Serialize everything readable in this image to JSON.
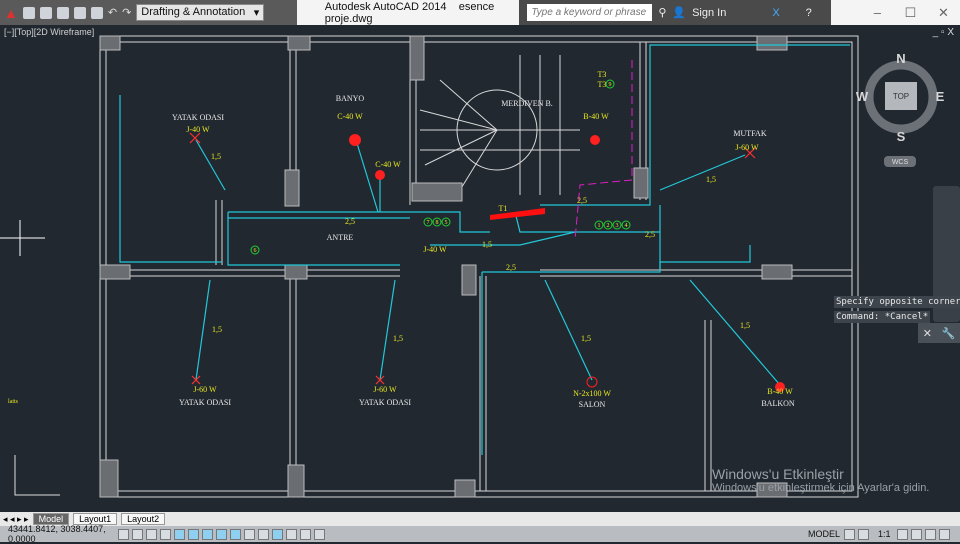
{
  "titlebar": {
    "workspace": "Drafting & Annotation",
    "app": "Autodesk AutoCAD 2014",
    "file": "esence proje.dwg",
    "search_placeholder": "Type a keyword or phrase",
    "sign_in": "Sign In",
    "minimize": "–",
    "maximize": "☐",
    "close": "✕"
  },
  "viewport": {
    "label": "[−][Top][2D Wireframe]",
    "controls": "_ ▫ X"
  },
  "viewcube": {
    "n": "N",
    "s": "S",
    "e": "E",
    "w": "W",
    "top": "TOP",
    "wcs": "WCS"
  },
  "drawing": {
    "rooms": [
      {
        "name": "YATAK ODASI",
        "load": "J-40 W"
      },
      {
        "name": "BANYO",
        "load": "C-40 W"
      },
      {
        "name": "MERDIVEN B.",
        "load": ""
      },
      {
        "name": "MUTFAK",
        "load": "J-60 W"
      },
      {
        "name": "ANTRE",
        "load": "J-40 W"
      },
      {
        "name": "YATAK ODASI",
        "load": "J-60 W"
      },
      {
        "name": "YATAK ODASI",
        "load": "J-60 W"
      },
      {
        "name": "SALON",
        "load": "N-2x100 W"
      },
      {
        "name": "BALKON",
        "load": "B-40 W"
      }
    ],
    "extra_loads": {
      "banyo2": "C-40 W",
      "stair": "B-40 W"
    },
    "panel": "T1",
    "t3a": "T3",
    "t3b": "T3",
    "sections": {
      "s15": "1,5",
      "s25": "2,5"
    },
    "circuits": [
      "1",
      "2",
      "3",
      "4",
      "5",
      "6",
      "7",
      "8",
      "9"
    ],
    "side_text": "latts"
  },
  "command": {
    "line1": "Specify opposite corner:",
    "line2": "Command: *Cancel*"
  },
  "watermark": {
    "line1": "Windows'u Etkinleştir",
    "line2": "Windows'u etkinleştirmek için Ayarlar'a gidin."
  },
  "tabs": [
    "Model",
    "Layout1",
    "Layout2"
  ],
  "status": {
    "coords": "43441.8412, 3038.4407, 0.0000",
    "model": "MODEL",
    "scale": "1:1"
  }
}
